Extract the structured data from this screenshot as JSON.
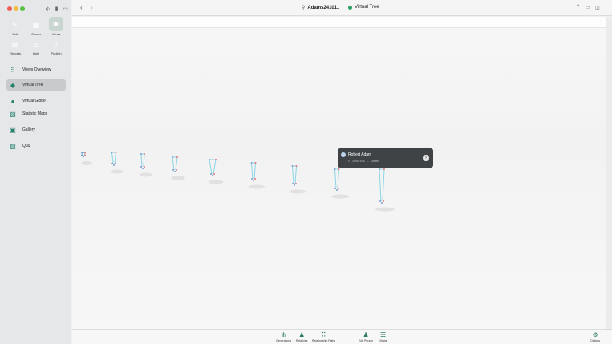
{
  "window": {
    "title": "Adams241011",
    "view_name": "Virtual Tree"
  },
  "sidebar": {
    "tiles": [
      {
        "label": "Edit",
        "icon": "pencil-icon",
        "color": "#2f7fd6"
      },
      {
        "label": "Charts",
        "icon": "charts-icon",
        "color": "#2a9a8a"
      },
      {
        "label": "Views",
        "icon": "eye-icon",
        "color": "#25a06a"
      },
      {
        "label": "Reports",
        "icon": "report-icon",
        "color": "#e58a2b"
      },
      {
        "label": "Lists",
        "icon": "list-icon",
        "color": "#c2407a"
      },
      {
        "label": "Publish",
        "icon": "upload-icon",
        "color": "#8a3fb8"
      }
    ],
    "items": [
      {
        "label": "Views Overview",
        "icon": "grid-icon"
      },
      {
        "label": "Virtual Tree",
        "icon": "tree-cube-icon"
      },
      {
        "label": "Virtual Globe",
        "icon": "globe-icon"
      },
      {
        "label": "Statistic Maps",
        "icon": "map-icon"
      },
      {
        "label": "Gallery",
        "icon": "gallery-icon"
      },
      {
        "label": "Quiz",
        "icon": "quiz-icon"
      }
    ],
    "selected_item": "Virtual Tree"
  },
  "popup": {
    "name": "Robert Adam",
    "detail_date": "19/9/1574",
    "detail_event": "Death"
  },
  "bottombar": {
    "items": [
      {
        "label": "Generations",
        "icon": "generations-icon"
      },
      {
        "label": "Relatives",
        "icon": "relatives-icon"
      },
      {
        "label": "Relationship Paths",
        "icon": "relationship-paths-icon"
      },
      {
        "label": "Edit Person",
        "icon": "edit-person-icon"
      },
      {
        "label": "Views",
        "icon": "views-icon"
      },
      {
        "label": "Options",
        "icon": "options-gear-icon"
      }
    ]
  },
  "colors": {
    "accent": "#2e9f68",
    "popup_bg": "#3f4346",
    "tree_line": "#8ad4e6"
  }
}
